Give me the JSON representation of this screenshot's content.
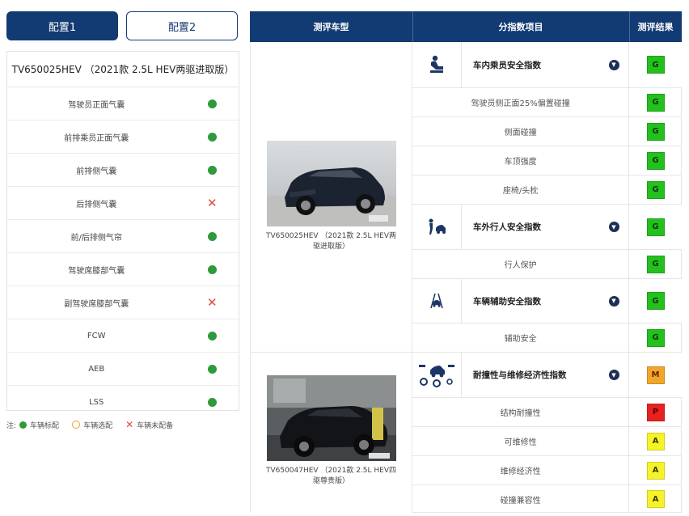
{
  "tabs": {
    "config1": "配置1",
    "config2": "配置2"
  },
  "left_panel": {
    "title": "TV650025HEV （2021款 2.5L HEV两驱进取版）",
    "rows": [
      {
        "label": "驾驶员正面气囊",
        "mark": "standard"
      },
      {
        "label": "前排乘员正面气囊",
        "mark": "standard"
      },
      {
        "label": "前排侧气囊",
        "mark": "standard"
      },
      {
        "label": "后排侧气囊",
        "mark": "none"
      },
      {
        "label": "前/后排侧气帘",
        "mark": "standard"
      },
      {
        "label": "驾驶席膝部气囊",
        "mark": "standard"
      },
      {
        "label": "副驾驶席膝部气囊",
        "mark": "none"
      },
      {
        "label": "FCW",
        "mark": "standard"
      },
      {
        "label": "AEB",
        "mark": "standard"
      },
      {
        "label": "LSS",
        "mark": "standard"
      }
    ]
  },
  "legend": {
    "prefix": "注:",
    "standard": "车辆标配",
    "optional": "车辆选配",
    "none": "车辆未配备"
  },
  "table": {
    "headers": {
      "car_model": "测评车型",
      "sub_index": "分指数项目",
      "result": "测评结果"
    },
    "cars": [
      {
        "caption": "TV650025HEV （2021款 2.5L HEV两驱进取版）"
      },
      {
        "caption": "TV650047HEV （2021款 2.5L HEV四驱尊贵版）"
      }
    ],
    "categories": {
      "occupant": {
        "name": "车内乘员安全指数",
        "icon": "seated-occupant-icon",
        "grade": "G"
      },
      "pedestrian": {
        "name": "车外行人安全指数",
        "icon": "pedestrian-icon",
        "grade": "G"
      },
      "assist": {
        "name": "车辆辅助安全指数",
        "icon": "driver-assist-icon",
        "grade": "G"
      },
      "durability": {
        "name": "耐撞性与维修经济性指数",
        "icon": "repair-gears-icon",
        "grade": "M"
      }
    },
    "items": {
      "occ1": {
        "name": "驾驶员侧正面25%偏置碰撞",
        "grade": "G"
      },
      "occ2": {
        "name": "侧面碰撞",
        "grade": "G"
      },
      "occ3": {
        "name": "车顶强度",
        "grade": "G"
      },
      "occ4": {
        "name": "座椅/头枕",
        "grade": "G"
      },
      "ped1": {
        "name": "行人保护",
        "grade": "G"
      },
      "ast1": {
        "name": "辅助安全",
        "grade": "G"
      },
      "dur1": {
        "name": "结构耐撞性",
        "grade": "P"
      },
      "dur2": {
        "name": "可维修性",
        "grade": "A"
      },
      "dur3": {
        "name": "维修经济性",
        "grade": "A"
      },
      "dur4": {
        "name": "碰撞兼容性",
        "grade": "A"
      }
    }
  },
  "colors": {
    "navy": "#123a73",
    "good": "#23c01e",
    "marginal": "#f2a52a",
    "poor": "#e82020",
    "acceptable": "#f6f229",
    "standard_dot": "#2f9a3a",
    "cross": "#e04a3a"
  }
}
